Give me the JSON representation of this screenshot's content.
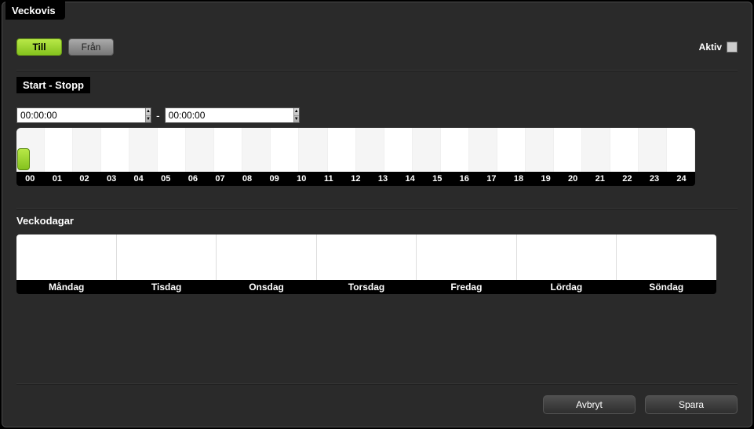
{
  "title": "Veckovis",
  "toggles": {
    "on": "Till",
    "off": "Från"
  },
  "active_label": "Aktiv",
  "active_checked": false,
  "section_startstop": "Start - Stopp",
  "time_start": "00:00:00",
  "time_stop": "00:00:00",
  "hours": [
    "00",
    "01",
    "02",
    "03",
    "04",
    "05",
    "06",
    "07",
    "08",
    "09",
    "10",
    "11",
    "12",
    "13",
    "14",
    "15",
    "16",
    "17",
    "18",
    "19",
    "20",
    "21",
    "22",
    "23",
    "24"
  ],
  "section_days": "Veckodagar",
  "days": [
    "Måndag",
    "Tisdag",
    "Onsdag",
    "Torsdag",
    "Fredag",
    "Lördag",
    "Söndag"
  ],
  "buttons": {
    "cancel": "Avbryt",
    "save": "Spara"
  }
}
